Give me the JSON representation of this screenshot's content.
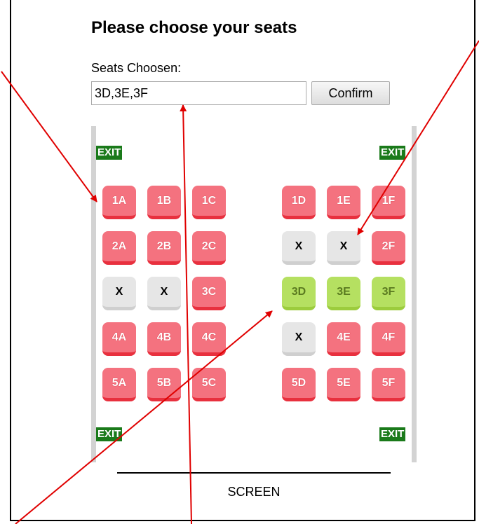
{
  "page": {
    "title": "Please choose your seats",
    "seats_label": "Seats Choosen:",
    "seats_value": "3D,3E,3F",
    "confirm_label": "Confirm",
    "exit_label": "EXIT",
    "screen_label": "SCREEN"
  },
  "seats": [
    {
      "id": "1A",
      "label": "1A",
      "state": "available"
    },
    {
      "id": "1B",
      "label": "1B",
      "state": "available"
    },
    {
      "id": "1C",
      "label": "1C",
      "state": "available"
    },
    {
      "id": "1D",
      "label": "1D",
      "state": "available"
    },
    {
      "id": "1E",
      "label": "1E",
      "state": "available"
    },
    {
      "id": "1F",
      "label": "1F",
      "state": "available"
    },
    {
      "id": "2A",
      "label": "2A",
      "state": "available"
    },
    {
      "id": "2B",
      "label": "2B",
      "state": "available"
    },
    {
      "id": "2C",
      "label": "2C",
      "state": "available"
    },
    {
      "id": "2D",
      "label": "X",
      "state": "taken"
    },
    {
      "id": "2E",
      "label": "X",
      "state": "taken"
    },
    {
      "id": "2F",
      "label": "2F",
      "state": "available"
    },
    {
      "id": "3A",
      "label": "X",
      "state": "taken"
    },
    {
      "id": "3B",
      "label": "X",
      "state": "taken"
    },
    {
      "id": "3C",
      "label": "3C",
      "state": "available"
    },
    {
      "id": "3D",
      "label": "3D",
      "state": "selected"
    },
    {
      "id": "3E",
      "label": "3E",
      "state": "selected"
    },
    {
      "id": "3F",
      "label": "3F",
      "state": "selected"
    },
    {
      "id": "4A",
      "label": "4A",
      "state": "available"
    },
    {
      "id": "4B",
      "label": "4B",
      "state": "available"
    },
    {
      "id": "4C",
      "label": "4C",
      "state": "available"
    },
    {
      "id": "4D",
      "label": "X",
      "state": "taken"
    },
    {
      "id": "4E",
      "label": "4E",
      "state": "available"
    },
    {
      "id": "4F",
      "label": "4F",
      "state": "available"
    },
    {
      "id": "5A",
      "label": "5A",
      "state": "available"
    },
    {
      "id": "5B",
      "label": "5B",
      "state": "available"
    },
    {
      "id": "5C",
      "label": "5C",
      "state": "available"
    },
    {
      "id": "5D",
      "label": "5D",
      "state": "available"
    },
    {
      "id": "5E",
      "label": "5E",
      "state": "available"
    },
    {
      "id": "5F",
      "label": "5F",
      "state": "available"
    }
  ],
  "colors": {
    "available": "#f4727f",
    "selected": "#b5e061",
    "taken": "#e6e6e6",
    "exit": "#1a7a1a",
    "annotation_arrow": "#e00000"
  }
}
